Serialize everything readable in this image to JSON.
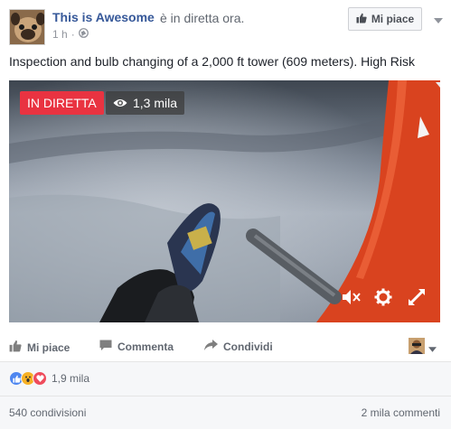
{
  "post": {
    "page_name": "This is Awesome",
    "live_status": "è in diretta ora.",
    "time": "1 h",
    "separator": "·",
    "audience_icon": "globe-icon",
    "like_page_label": "Mi piace",
    "text": "Inspection and bulb changing of a 2,000 ft tower (609 meters). High Risk"
  },
  "video": {
    "live_label": "IN DIRETTA",
    "viewers": "1,3 mila",
    "controls": [
      "mute-icon",
      "settings-icon",
      "fullscreen-icon"
    ]
  },
  "actions": {
    "like": "Mi piace",
    "comment": "Commenta",
    "share": "Condividi"
  },
  "stats": {
    "reactions": [
      "like",
      "wow",
      "love"
    ],
    "reaction_count": "1,9 mila",
    "shares": "540 condivisioni",
    "comments": "2 mila commenti"
  },
  "colors": {
    "link": "#365899",
    "live_red": "#e93341",
    "muted": "#616770",
    "tower_orange": "#d9431f"
  }
}
